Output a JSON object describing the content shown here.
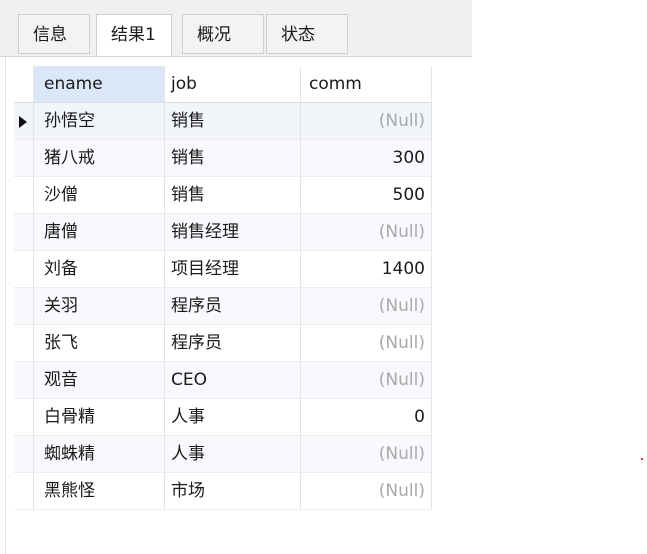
{
  "tabs": [
    {
      "label": "信息",
      "active": false
    },
    {
      "label": "结果1",
      "active": true
    },
    {
      "label": "概况",
      "active": false
    },
    {
      "label": "状态",
      "active": false
    }
  ],
  "columns": [
    "ename",
    "job",
    "comm"
  ],
  "rows": [
    {
      "ename": "孙悟空",
      "job": "销售",
      "comm": "(Null)"
    },
    {
      "ename": "猪八戒",
      "job": "销售",
      "comm": "300"
    },
    {
      "ename": "沙僧",
      "job": "销售",
      "comm": "500"
    },
    {
      "ename": "唐僧",
      "job": "销售经理",
      "comm": "(Null)"
    },
    {
      "ename": "刘备",
      "job": "项目经理",
      "comm": "1400"
    },
    {
      "ename": "关羽",
      "job": "程序员",
      "comm": "(Null)"
    },
    {
      "ename": "张飞",
      "job": "程序员",
      "comm": "(Null)"
    },
    {
      "ename": "观音",
      "job": "CEO",
      "comm": "(Null)"
    },
    {
      "ename": "白骨精",
      "job": "人事",
      "comm": "0"
    },
    {
      "ename": "蜘蛛精",
      "job": "人事",
      "comm": "(Null)"
    },
    {
      "ename": "黑熊怪",
      "job": "市场",
      "comm": "(Null)"
    }
  ],
  "current_row_index": 0,
  "colors": {
    "header_selected": "#dbe7f6",
    "null_text": "#a9a9a9"
  }
}
